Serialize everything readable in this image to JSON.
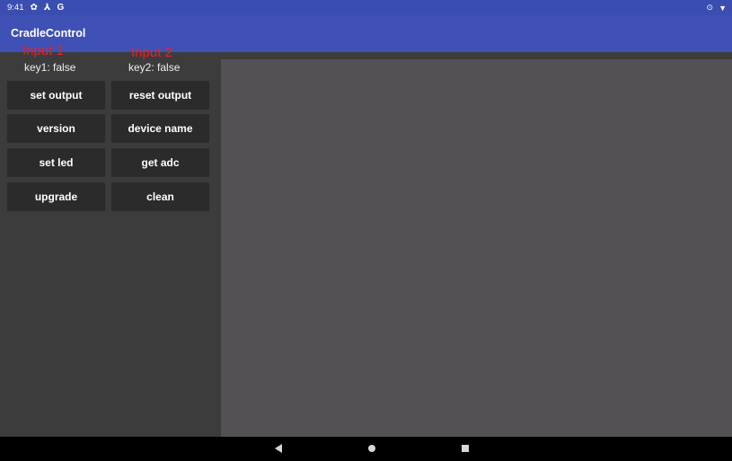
{
  "status_bar": {
    "time": "9:41",
    "icons": [
      "gear-icon",
      "usb-icon",
      "google-icon"
    ],
    "icon_glyphs": [
      "✿",
      "⅄",
      "G"
    ],
    "right_icons": [
      "sync-icon",
      "wifi-icon"
    ],
    "right_glyphs": [
      "⊙",
      "▼"
    ]
  },
  "app_bar": {
    "title": "CradleControl",
    "color": "#3f51b5"
  },
  "annotations": {
    "input1": "Input 1",
    "input2": "Input 2",
    "color": "#e8212b"
  },
  "keys": {
    "key1": "key1:   false",
    "key2": "key2:   false"
  },
  "buttons": {
    "set_output": "set output",
    "reset_output": "reset output",
    "version": "version",
    "device_name": "device name",
    "set_led": "set led",
    "get_adc": "get adc",
    "upgrade": "upgrade",
    "clean": "clean"
  },
  "nav": {
    "back": "back-icon",
    "home": "home-icon",
    "recents": "recents-icon"
  }
}
